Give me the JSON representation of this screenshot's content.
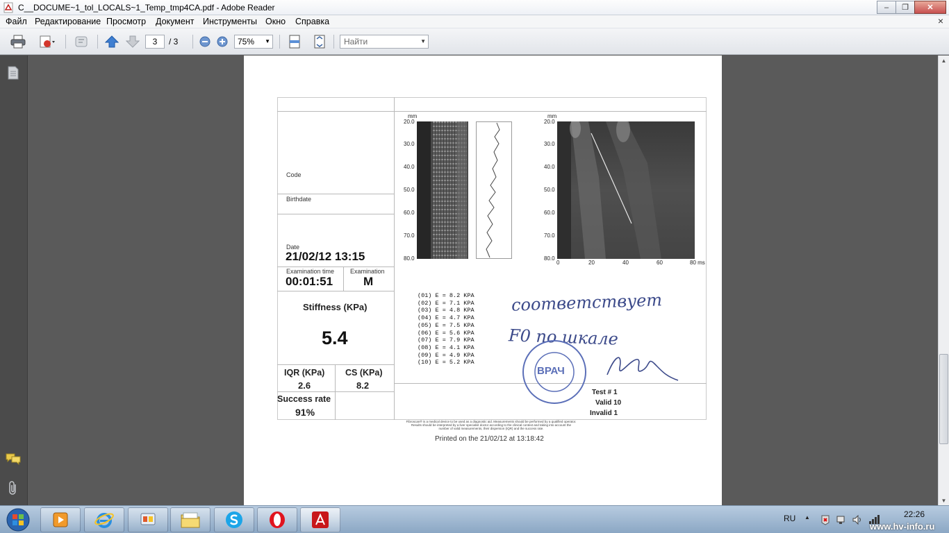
{
  "window": {
    "title": "C__DOCUME~1_tol_LOCALS~1_Temp_tmp4CA.pdf - Adobe Reader"
  },
  "menu": {
    "items": [
      "Файл",
      "Редактирование",
      "Просмотр",
      "Документ",
      "Инструменты",
      "Окно",
      "Справка"
    ]
  },
  "toolbar": {
    "page_current": "3",
    "page_total": "/ 3",
    "zoom": "75%",
    "find_placeholder": "Найти"
  },
  "report": {
    "code_label": "Code",
    "birthdate_label": "Birthdate",
    "date_label": "Date",
    "date_value": "21/02/12 13:15",
    "exam_time_label": "Examination time",
    "exam_time_value": "00:01:51",
    "exam_label": "Examination",
    "exam_value": "M",
    "stiffness_label": "Stiffness (KPa)",
    "stiffness_value": "5.4",
    "iqr_label": "IQR (KPa)",
    "iqr_value": "2.6",
    "cs_label": "CS (KPa)",
    "cs_value": "8.2",
    "success_label": "Success rate",
    "success_value": "91%",
    "mm_label": "mm",
    "mm_label_2": "mm",
    "depth_ticks": [
      "20.0",
      "30.0",
      "40.0",
      "50.0",
      "60.0",
      "70.0",
      "80.0"
    ],
    "depth_ticks_2": [
      "20.0",
      "30.0",
      "40.0",
      "50.0",
      "60.0",
      "70.0",
      "80.0"
    ],
    "ms_ticks": [
      "0",
      "20",
      "40",
      "60",
      "80 ms"
    ],
    "measurements": [
      "(01) E = 8.2 KPA",
      "(02) E = 7.1 KPA",
      "(03) E = 4.8 KPA",
      "(04) E = 4.7 KPA",
      "(05) E = 7.5 KPA",
      "(06) E = 5.6 KPA",
      "(07) E = 7.9 KPA",
      "(08) E = 4.1 KPA",
      "(09) E = 4.9 KPA",
      "(10) E = 5.2 KPA"
    ],
    "test_label": "Test # 1",
    "valid_label": "Valid 10",
    "invalid_label": "Invalid 1",
    "handwriting_1": "соответствует",
    "handwriting_2": "F0 по шкале",
    "stamp_text": "ВРАЧ",
    "footer_line_1": "Fibroscan® is a medical device to be used as a diagnostic aid. Measurements should be performed by a qualified operator.",
    "footer_line_2": "Results should be interpreted by a liver specialist doctor according to the clinical context and taking into account the",
    "footer_line_3": "number of valid measurements, their dispersion (IQR) and the success rate.",
    "printed_on": "Printed on the 21/02/12 at 13:18:42"
  },
  "taskbar": {
    "language": "RU",
    "time": "22:26",
    "watermark": "www.hv-info.ru"
  }
}
